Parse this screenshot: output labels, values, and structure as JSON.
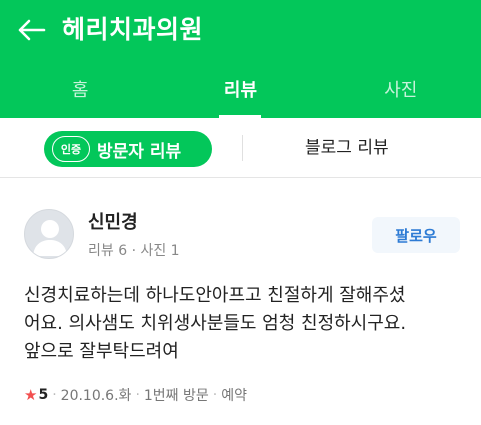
{
  "header": {
    "title": "헤리치과의원",
    "back_icon": "arrow-left-icon"
  },
  "tabs": [
    {
      "label": "홈"
    },
    {
      "label": "리뷰",
      "active": true
    },
    {
      "label": "사진"
    }
  ],
  "subtabs": {
    "verified_badge": "인증",
    "visitor_label": "방문자 리뷰",
    "blog_label": "블로그 리뷰"
  },
  "review": {
    "user_name": "신민경",
    "user_stats": "리뷰 6 · 사진 1",
    "follow_label": "팔로우",
    "text_lines": [
      "신경치료하는데 하나도안아프고 친절하게 잘해주셨",
      "어요. 의사샘도 치위생사분들도 엄청 친정하시구요.",
      "앞으로 잘부탁드려여"
    ],
    "rating": "5",
    "date": "20.10.6.화",
    "visit_count": "1번째 방문",
    "reservation": "예약"
  },
  "colors": {
    "brand": "#03c75a",
    "follow_text": "#2d7bd4",
    "star": "#f24f4f"
  }
}
